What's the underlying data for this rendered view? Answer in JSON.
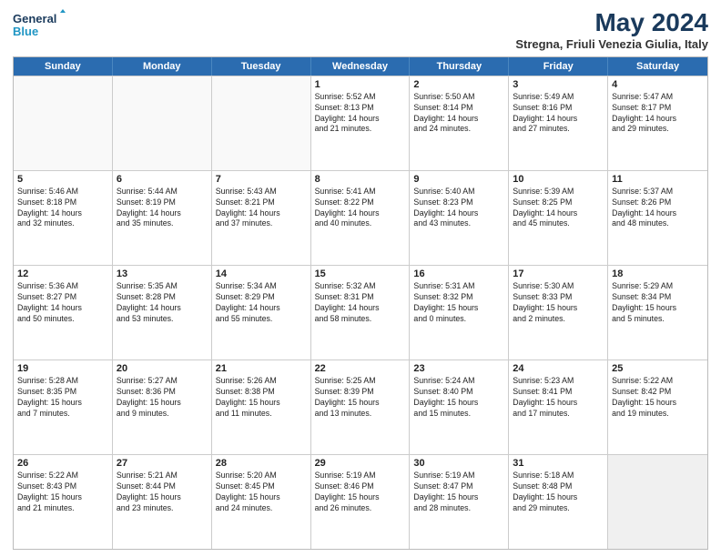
{
  "logo": {
    "line1": "General",
    "line2": "Blue"
  },
  "title": "May 2024",
  "subtitle": "Stregna, Friuli Venezia Giulia, Italy",
  "weekdays": [
    "Sunday",
    "Monday",
    "Tuesday",
    "Wednesday",
    "Thursday",
    "Friday",
    "Saturday"
  ],
  "rows": [
    [
      {
        "day": "",
        "lines": [],
        "empty": true
      },
      {
        "day": "",
        "lines": [],
        "empty": true
      },
      {
        "day": "",
        "lines": [],
        "empty": true
      },
      {
        "day": "1",
        "lines": [
          "Sunrise: 5:52 AM",
          "Sunset: 8:13 PM",
          "Daylight: 14 hours",
          "and 21 minutes."
        ]
      },
      {
        "day": "2",
        "lines": [
          "Sunrise: 5:50 AM",
          "Sunset: 8:14 PM",
          "Daylight: 14 hours",
          "and 24 minutes."
        ]
      },
      {
        "day": "3",
        "lines": [
          "Sunrise: 5:49 AM",
          "Sunset: 8:16 PM",
          "Daylight: 14 hours",
          "and 27 minutes."
        ]
      },
      {
        "day": "4",
        "lines": [
          "Sunrise: 5:47 AM",
          "Sunset: 8:17 PM",
          "Daylight: 14 hours",
          "and 29 minutes."
        ]
      }
    ],
    [
      {
        "day": "5",
        "lines": [
          "Sunrise: 5:46 AM",
          "Sunset: 8:18 PM",
          "Daylight: 14 hours",
          "and 32 minutes."
        ]
      },
      {
        "day": "6",
        "lines": [
          "Sunrise: 5:44 AM",
          "Sunset: 8:19 PM",
          "Daylight: 14 hours",
          "and 35 minutes."
        ]
      },
      {
        "day": "7",
        "lines": [
          "Sunrise: 5:43 AM",
          "Sunset: 8:21 PM",
          "Daylight: 14 hours",
          "and 37 minutes."
        ]
      },
      {
        "day": "8",
        "lines": [
          "Sunrise: 5:41 AM",
          "Sunset: 8:22 PM",
          "Daylight: 14 hours",
          "and 40 minutes."
        ]
      },
      {
        "day": "9",
        "lines": [
          "Sunrise: 5:40 AM",
          "Sunset: 8:23 PM",
          "Daylight: 14 hours",
          "and 43 minutes."
        ]
      },
      {
        "day": "10",
        "lines": [
          "Sunrise: 5:39 AM",
          "Sunset: 8:25 PM",
          "Daylight: 14 hours",
          "and 45 minutes."
        ]
      },
      {
        "day": "11",
        "lines": [
          "Sunrise: 5:37 AM",
          "Sunset: 8:26 PM",
          "Daylight: 14 hours",
          "and 48 minutes."
        ]
      }
    ],
    [
      {
        "day": "12",
        "lines": [
          "Sunrise: 5:36 AM",
          "Sunset: 8:27 PM",
          "Daylight: 14 hours",
          "and 50 minutes."
        ]
      },
      {
        "day": "13",
        "lines": [
          "Sunrise: 5:35 AM",
          "Sunset: 8:28 PM",
          "Daylight: 14 hours",
          "and 53 minutes."
        ]
      },
      {
        "day": "14",
        "lines": [
          "Sunrise: 5:34 AM",
          "Sunset: 8:29 PM",
          "Daylight: 14 hours",
          "and 55 minutes."
        ]
      },
      {
        "day": "15",
        "lines": [
          "Sunrise: 5:32 AM",
          "Sunset: 8:31 PM",
          "Daylight: 14 hours",
          "and 58 minutes."
        ]
      },
      {
        "day": "16",
        "lines": [
          "Sunrise: 5:31 AM",
          "Sunset: 8:32 PM",
          "Daylight: 15 hours",
          "and 0 minutes."
        ]
      },
      {
        "day": "17",
        "lines": [
          "Sunrise: 5:30 AM",
          "Sunset: 8:33 PM",
          "Daylight: 15 hours",
          "and 2 minutes."
        ]
      },
      {
        "day": "18",
        "lines": [
          "Sunrise: 5:29 AM",
          "Sunset: 8:34 PM",
          "Daylight: 15 hours",
          "and 5 minutes."
        ]
      }
    ],
    [
      {
        "day": "19",
        "lines": [
          "Sunrise: 5:28 AM",
          "Sunset: 8:35 PM",
          "Daylight: 15 hours",
          "and 7 minutes."
        ]
      },
      {
        "day": "20",
        "lines": [
          "Sunrise: 5:27 AM",
          "Sunset: 8:36 PM",
          "Daylight: 15 hours",
          "and 9 minutes."
        ]
      },
      {
        "day": "21",
        "lines": [
          "Sunrise: 5:26 AM",
          "Sunset: 8:38 PM",
          "Daylight: 15 hours",
          "and 11 minutes."
        ]
      },
      {
        "day": "22",
        "lines": [
          "Sunrise: 5:25 AM",
          "Sunset: 8:39 PM",
          "Daylight: 15 hours",
          "and 13 minutes."
        ]
      },
      {
        "day": "23",
        "lines": [
          "Sunrise: 5:24 AM",
          "Sunset: 8:40 PM",
          "Daylight: 15 hours",
          "and 15 minutes."
        ]
      },
      {
        "day": "24",
        "lines": [
          "Sunrise: 5:23 AM",
          "Sunset: 8:41 PM",
          "Daylight: 15 hours",
          "and 17 minutes."
        ]
      },
      {
        "day": "25",
        "lines": [
          "Sunrise: 5:22 AM",
          "Sunset: 8:42 PM",
          "Daylight: 15 hours",
          "and 19 minutes."
        ]
      }
    ],
    [
      {
        "day": "26",
        "lines": [
          "Sunrise: 5:22 AM",
          "Sunset: 8:43 PM",
          "Daylight: 15 hours",
          "and 21 minutes."
        ]
      },
      {
        "day": "27",
        "lines": [
          "Sunrise: 5:21 AM",
          "Sunset: 8:44 PM",
          "Daylight: 15 hours",
          "and 23 minutes."
        ]
      },
      {
        "day": "28",
        "lines": [
          "Sunrise: 5:20 AM",
          "Sunset: 8:45 PM",
          "Daylight: 15 hours",
          "and 24 minutes."
        ]
      },
      {
        "day": "29",
        "lines": [
          "Sunrise: 5:19 AM",
          "Sunset: 8:46 PM",
          "Daylight: 15 hours",
          "and 26 minutes."
        ]
      },
      {
        "day": "30",
        "lines": [
          "Sunrise: 5:19 AM",
          "Sunset: 8:47 PM",
          "Daylight: 15 hours",
          "and 28 minutes."
        ]
      },
      {
        "day": "31",
        "lines": [
          "Sunrise: 5:18 AM",
          "Sunset: 8:48 PM",
          "Daylight: 15 hours",
          "and 29 minutes."
        ]
      },
      {
        "day": "",
        "lines": [],
        "empty": true,
        "shaded": true
      }
    ]
  ]
}
